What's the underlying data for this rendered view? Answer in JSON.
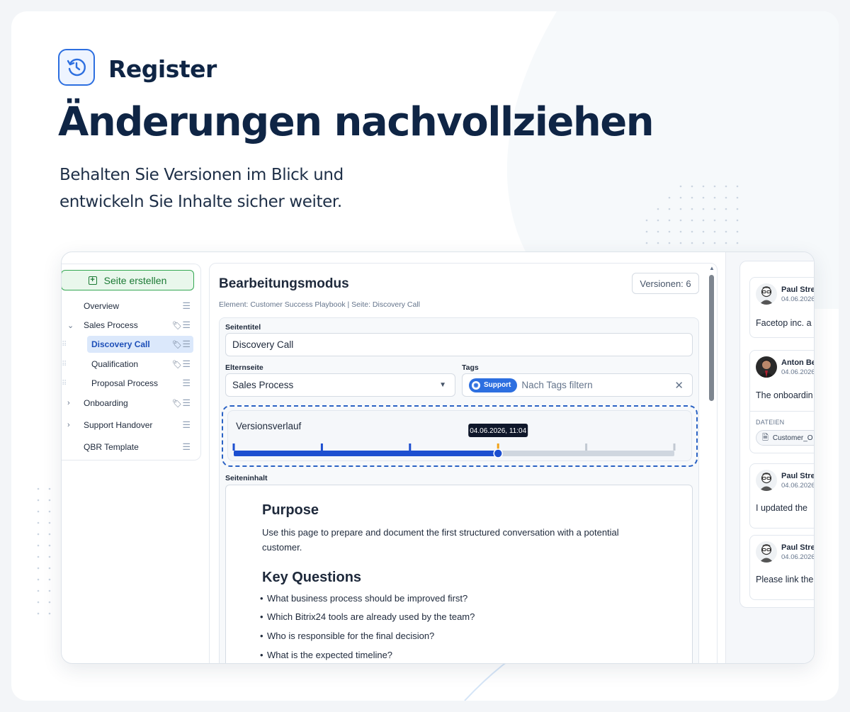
{
  "hero": {
    "label": "Register",
    "title": "Änderungen nachvollziehen",
    "subtitle_line1": "Behalten Sie Versionen im Blick und",
    "subtitle_line2": "entwickeln Sie Inhalte sicher weiter."
  },
  "sidebar": {
    "create_label": "Seite erstellen",
    "items": [
      {
        "label": "Overview"
      },
      {
        "label": "Sales Process"
      },
      {
        "label": "Discovery Call"
      },
      {
        "label": "Qualification"
      },
      {
        "label": "Proposal Process"
      },
      {
        "label": "Onboarding"
      },
      {
        "label": "Support Handover"
      },
      {
        "label": "QBR Template"
      }
    ]
  },
  "editor": {
    "title": "Bearbeitungsmodus",
    "versions_label": "Versionen: 6",
    "breadcrumb": "Element: Customer Success Playbook | Seite: Discovery Call",
    "page_title_label": "Seitentitel",
    "page_title_value": "Discovery Call",
    "parent_label": "Elternseite",
    "parent_value": "Sales Process",
    "tags_label": "Tags",
    "tag": "Support",
    "tags_placeholder": "Nach Tags filtern",
    "history_title": "Versionsverlauf",
    "history_tooltip": "04.06.2026, 11:04",
    "history": {
      "versions": 6,
      "current_version": 4
    },
    "content_label": "Seiteninhalt",
    "content": {
      "h1": "Purpose",
      "p1": "Use this page to prepare and document the first structured conversation with a potential customer.",
      "h2": "Key Questions",
      "questions": [
        "What business process should be improved first?",
        "Which Bitrix24 tools are already used by the team?",
        "Who is responsible for the final decision?",
        "What is the expected timeline?"
      ]
    }
  },
  "comments": [
    {
      "name": "Paul Stre",
      "date": "04.06.2026",
      "text": "Facetop inc. a"
    },
    {
      "name": "Anton Be",
      "date": "04.06.2026",
      "text": "The onboardin",
      "files_label": "DATEIEN",
      "file": "Customer_O"
    },
    {
      "name": "Paul Stre",
      "date": "04.06.2026",
      "text": "I updated the"
    },
    {
      "name": "Paul Stre",
      "date": "04.06.2026",
      "text": "Please link the"
    }
  ],
  "colors": {
    "accent": "#2d6fe0",
    "navy": "#0f2545",
    "green": "#35a853",
    "timeline_orange": "#f0a21a"
  }
}
